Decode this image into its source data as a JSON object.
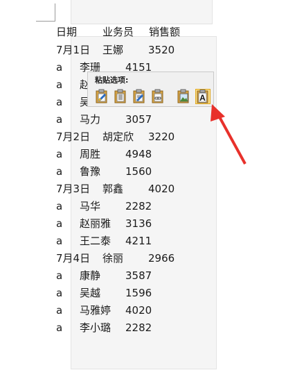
{
  "header": {
    "date": "日期",
    "salesman": "业务员",
    "sales": "销售额"
  },
  "rows": [
    {
      "a": "7月1日",
      "b": "王娜",
      "c": "3520"
    },
    {
      "a": "a",
      "b": "李珊",
      "c": "4151"
    },
    {
      "a": "a",
      "b": "赵",
      "c": ""
    },
    {
      "a": "a",
      "b": "吴",
      "c": ""
    },
    {
      "a": "a",
      "b": "马力",
      "c": "3057"
    },
    {
      "a": "7月2日",
      "b": "胡定欣",
      "c": "3220"
    },
    {
      "a": "a",
      "b": "周胜",
      "c": "4948"
    },
    {
      "a": "a",
      "b": "鲁豫",
      "c": "1560"
    },
    {
      "a": "7月3日",
      "b": "郭鑫",
      "c": "4020"
    },
    {
      "a": "a",
      "b": "马华",
      "c": "2282"
    },
    {
      "a": "a",
      "b": "赵丽雅",
      "c": "3136"
    },
    {
      "a": "a",
      "b": "王二泰",
      "c": "4211"
    },
    {
      "a": "7月4日",
      "b": "徐丽",
      "c": "2966"
    },
    {
      "a": "a",
      "b": "康静",
      "c": "3587"
    },
    {
      "a": "a",
      "b": "吴越",
      "c": "1596"
    },
    {
      "a": "a",
      "b": "马雅婷",
      "c": "4020"
    },
    {
      "a": "a",
      "b": "李小璐",
      "c": "2282"
    }
  ],
  "paste_options": {
    "title": "粘贴选项:",
    "icons": [
      "keep-source-formatting-icon",
      "merge-formatting-icon",
      "use-destination-styles-icon",
      "paste-link-icon",
      "paste-as-picture-icon",
      "keep-text-only-icon"
    ],
    "selected_icon": "keep-text-only-icon",
    "text_only_glyph": "A"
  },
  "colors": {
    "arrow": "#e8312b",
    "highlight": "#fde08a",
    "selection": "#f5f5f5"
  }
}
